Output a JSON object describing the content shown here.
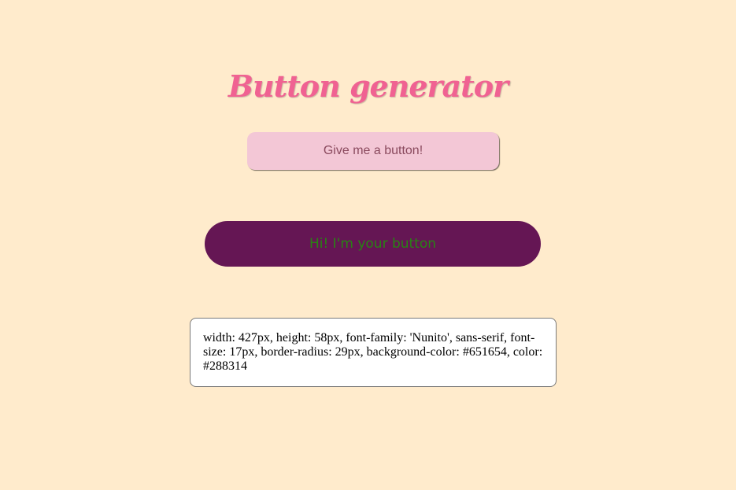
{
  "header": {
    "title": "Button generator"
  },
  "generator": {
    "button_label": "Give me a button!"
  },
  "preview": {
    "button_label": "Hi! I'm your button",
    "background_color": "#651654",
    "text_color": "#288314"
  },
  "css_output": {
    "text": "width: 427px, height: 58px, font-family: 'Nunito', sans-serif, font-size: 17px, border-radius: 29px, background-color: #651654, color: #288314"
  },
  "colors": {
    "page_background": "#ffebcc",
    "title": "#f06292",
    "generator_button": "#f3c7d6"
  }
}
